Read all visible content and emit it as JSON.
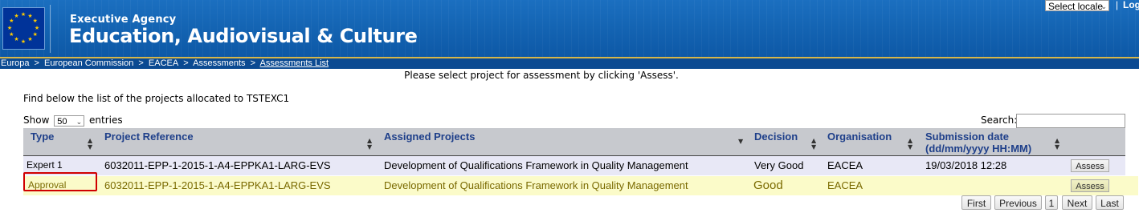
{
  "header": {
    "agency_subtitle": "Executive Agency",
    "agency_title": "Education, Audiovisual & Culture",
    "locale_select": "Select locale",
    "locale_separator": "|",
    "logout_label": "Log"
  },
  "breadcrumb": {
    "items": [
      "Europa",
      "European Commission",
      "EACEA",
      "Assessments",
      "Assessments List"
    ],
    "separator": ">"
  },
  "instruction": "Please select project for assessment by clicking 'Assess'.",
  "find_text": "Find below the list of the projects allocated to TSTEXC1",
  "length": {
    "show_label": "Show",
    "value": "50",
    "entries_label": "entries"
  },
  "search": {
    "label": "Search:",
    "value": ""
  },
  "table": {
    "headers": [
      "Type",
      "Project Reference",
      "Assigned Projects",
      "Decision",
      "Organisation",
      "Submission date",
      "(dd/mm/yyyy HH:MM)"
    ],
    "rows": [
      {
        "type": "Expert 1",
        "project_reference": "6032011-EPP-1-2015-1-A4-EPPKA1-LARG-EVS",
        "assigned_project": "Development of Qualifications Framework in Quality Management",
        "decision": "Very Good",
        "organisation": "EACEA",
        "submission_date": "19/03/2018 12:28",
        "action": "Assess"
      },
      {
        "type": "Approval",
        "project_reference": "6032011-EPP-1-2015-1-A4-EPPKA1-LARG-EVS",
        "assigned_project": "Development of Qualifications Framework in Quality Management",
        "decision": "Good",
        "organisation": "EACEA",
        "submission_date": "",
        "action": "Assess"
      }
    ]
  },
  "pagination": {
    "first": "First",
    "previous": "Previous",
    "page": "1",
    "next": "Next",
    "last": "Last"
  },
  "colors": {
    "header_blue": "#1566b5",
    "header_text": "#1e3f8a",
    "highlight_row": "#fbfbc9",
    "highlight_border": "#d00000"
  }
}
